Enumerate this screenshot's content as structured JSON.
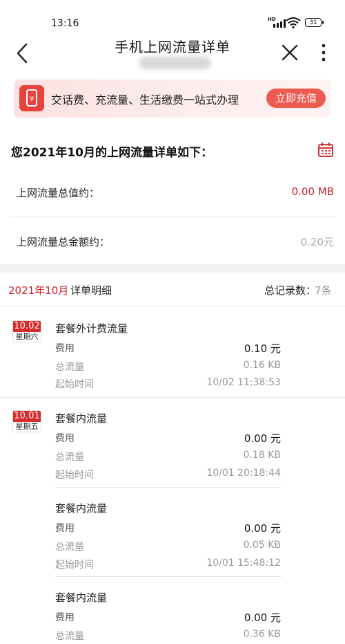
{
  "status_bar": {
    "time": "13:16",
    "network": "HD",
    "battery": "31"
  },
  "header": {
    "title": "手机上网流量详单",
    "back_icon": "chevron-left-icon",
    "close_icon": "close-icon",
    "more_icon": "more-vertical-icon"
  },
  "banner": {
    "text": "交话费、充流量、生活缴费一站式办理",
    "button": "立即充值",
    "icon": "phone-icon"
  },
  "summary": {
    "title": "您2021年10月的上网流量详单如下：",
    "rows": [
      {
        "label": "上网流量总值约：",
        "value": "0.00 MB"
      },
      {
        "label": "上网流量总金额约：",
        "value": "0.20元"
      }
    ]
  },
  "detail": {
    "month": "2021年10月",
    "title": "详单明细",
    "total_label": "总记录数：",
    "total_value": "7条"
  },
  "groups": [
    {
      "date": "10.02",
      "weekday": "星期六",
      "records": [
        {
          "title": "套餐外计费流量",
          "fee_label": "费用",
          "fee": "0.10 元",
          "flow_label": "总流量",
          "flow": "0.16 KB",
          "time_label": "起始时间",
          "time": "10/02 11:38:53"
        }
      ]
    },
    {
      "date": "10.01",
      "weekday": "星期五",
      "records": [
        {
          "title": "套餐内流量",
          "fee_label": "费用",
          "fee": "0.00 元",
          "flow_label": "总流量",
          "flow": "0.18 KB",
          "time_label": "起始时间",
          "time": "10/01 20:18:44"
        },
        {
          "title": "套餐内流量",
          "fee_label": "费用",
          "fee": "0.00 元",
          "flow_label": "总流量",
          "flow": "0.05 KB",
          "time_label": "起始时间",
          "time": "10/01 15:48:12"
        },
        {
          "title": "套餐内流量",
          "fee_label": "费用",
          "fee": "0.00 元",
          "flow_label": "总流量",
          "flow": "0.36 KB"
        }
      ]
    }
  ],
  "colors": {
    "accent": "#c8232c",
    "button": "#ef5a50",
    "badge": "#d92b2b"
  }
}
